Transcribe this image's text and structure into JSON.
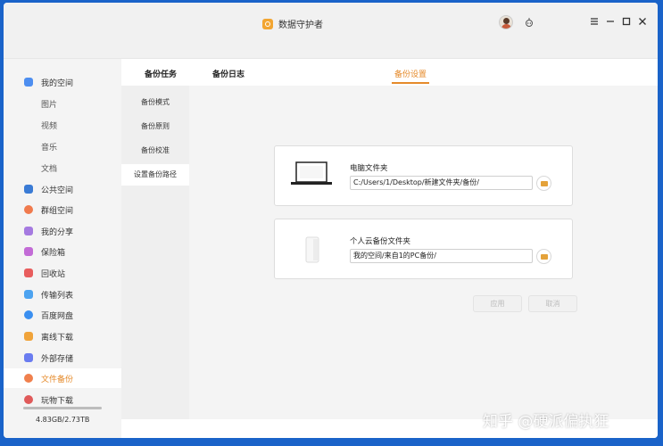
{
  "window": {
    "title": "数据守护者"
  },
  "sidebar": {
    "items": [
      {
        "label": "我的空间",
        "color": "#4d8ef0",
        "type": "main"
      },
      {
        "label": "图片",
        "type": "sub"
      },
      {
        "label": "视频",
        "type": "sub"
      },
      {
        "label": "音乐",
        "type": "sub"
      },
      {
        "label": "文档",
        "type": "sub"
      },
      {
        "label": "公共空间",
        "color": "#3a7bd5",
        "type": "main"
      },
      {
        "label": "群组空间",
        "color": "#f07a4d",
        "type": "main"
      },
      {
        "label": "我的分享",
        "color": "#a57ae0",
        "type": "main"
      },
      {
        "label": "保险箱",
        "color": "#c26bd6",
        "type": "main"
      },
      {
        "label": "回收站",
        "color": "#e85d5d",
        "type": "main"
      },
      {
        "label": "传输列表",
        "color": "#4da3f0",
        "type": "main"
      },
      {
        "label": "百度网盘",
        "color": "#3a8ff0",
        "type": "main"
      },
      {
        "label": "离线下载",
        "color": "#f0a33a",
        "type": "main"
      },
      {
        "label": "外部存储",
        "color": "#6a7cf0",
        "type": "main"
      },
      {
        "label": "文件备份",
        "color": "#f0804d",
        "type": "main"
      },
      {
        "label": "玩物下载",
        "color": "#e05a5a",
        "type": "main"
      }
    ],
    "storage": {
      "text": "4.83GB/2.73TB",
      "used_fraction": 1.0
    }
  },
  "tabs": [
    {
      "label": "备份任务"
    },
    {
      "label": "备份日志"
    },
    {
      "label": "备份设置"
    }
  ],
  "subnav": [
    {
      "label": "备份模式"
    },
    {
      "label": "备份原则"
    },
    {
      "label": "备份校准"
    },
    {
      "label": "设置备份路径"
    }
  ],
  "cards": {
    "pc": {
      "title": "电脑文件夹",
      "path": "C:/Users/1/Desktop/新建文件夹/备份/"
    },
    "cloud": {
      "title": "个人云备份文件夹",
      "path": "我的空间/来自1的PC备份/"
    }
  },
  "buttons": {
    "apply": "应用",
    "cancel": "取消"
  },
  "watermark": "知乎 @硬派偏执狂",
  "accent_color": "#e58a2a"
}
